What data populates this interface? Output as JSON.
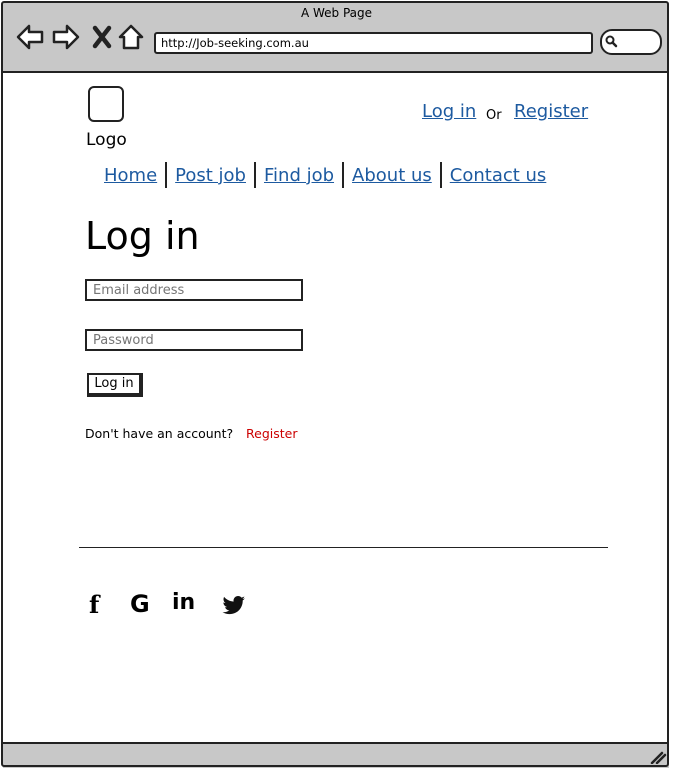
{
  "window": {
    "title": "A Web Page",
    "url": "http://Job-seeking.com.au"
  },
  "browser_icons": [
    "back-arrow-icon",
    "forward-arrow-icon",
    "close-x-icon",
    "home-icon",
    "search-icon",
    "resize-grip-icon"
  ],
  "header": {
    "logo_label": "Logo",
    "login_link": "Log in",
    "or_text": "Or",
    "register_link": "Register"
  },
  "nav": {
    "items": [
      {
        "label": "Home"
      },
      {
        "label": "Post job"
      },
      {
        "label": "Find job"
      },
      {
        "label": "About us"
      },
      {
        "label": "Contact us"
      }
    ]
  },
  "form": {
    "heading": "Log in",
    "email_placeholder": "Email address",
    "password_placeholder": "Password",
    "submit_label": "Log in",
    "no_account_text": "Don't have an account?",
    "register_label": "Register"
  },
  "footer": {
    "social": [
      {
        "name": "facebook-icon",
        "glyph": "f"
      },
      {
        "name": "google-icon",
        "glyph": "G"
      },
      {
        "name": "linkedin-icon",
        "glyph": "in"
      },
      {
        "name": "twitter-icon",
        "glyph": "🐦"
      }
    ]
  },
  "colors": {
    "link": "#1d5aa0",
    "register_accent": "#cc0000",
    "chrome": "#c8c8c8"
  }
}
